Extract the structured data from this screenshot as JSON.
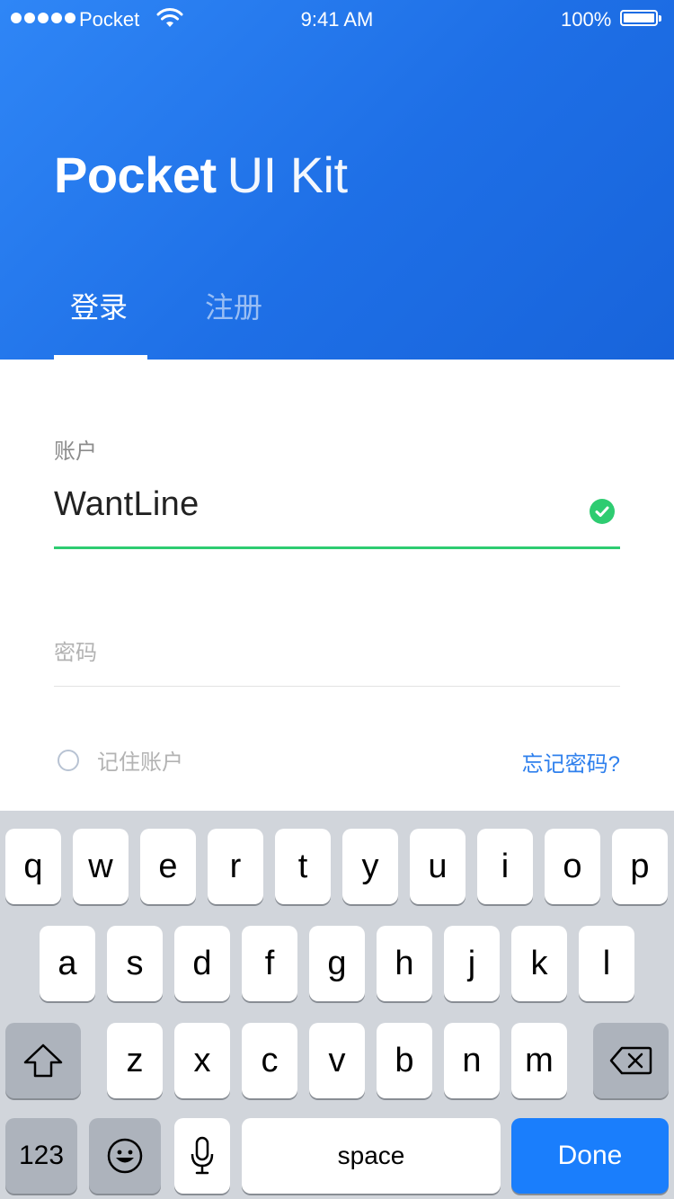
{
  "status_bar": {
    "carrier": "Pocket",
    "time": "9:41 AM",
    "battery": "100%"
  },
  "brand": {
    "bold": "Pocket",
    "light": "UI Kit"
  },
  "tabs": [
    {
      "label": "登录",
      "active": true
    },
    {
      "label": "注册",
      "active": false
    }
  ],
  "form": {
    "account_label": "账户",
    "account_value": "WantLine",
    "password_label": "密码",
    "remember_label": "记住账户",
    "forgot_link": "忘记密码?"
  },
  "colors": {
    "accent": "#2f80ed",
    "success": "#2ecc71",
    "header_gradient_start": "#2f86f6",
    "header_gradient_end": "#1864db",
    "done_key": "#1a7efc"
  },
  "keyboard": {
    "row1": [
      "q",
      "w",
      "e",
      "r",
      "t",
      "y",
      "u",
      "i",
      "o",
      "p"
    ],
    "row2": [
      "a",
      "s",
      "d",
      "f",
      "g",
      "h",
      "j",
      "k",
      "l"
    ],
    "row3": [
      "z",
      "x",
      "c",
      "v",
      "b",
      "n",
      "m"
    ],
    "numbers_key": "123",
    "space_key": "space",
    "done_key": "Done",
    "icons": {
      "shift": "shift-icon",
      "delete": "backspace-icon",
      "emoji": "emoji-icon",
      "mic": "microphone-icon"
    }
  }
}
